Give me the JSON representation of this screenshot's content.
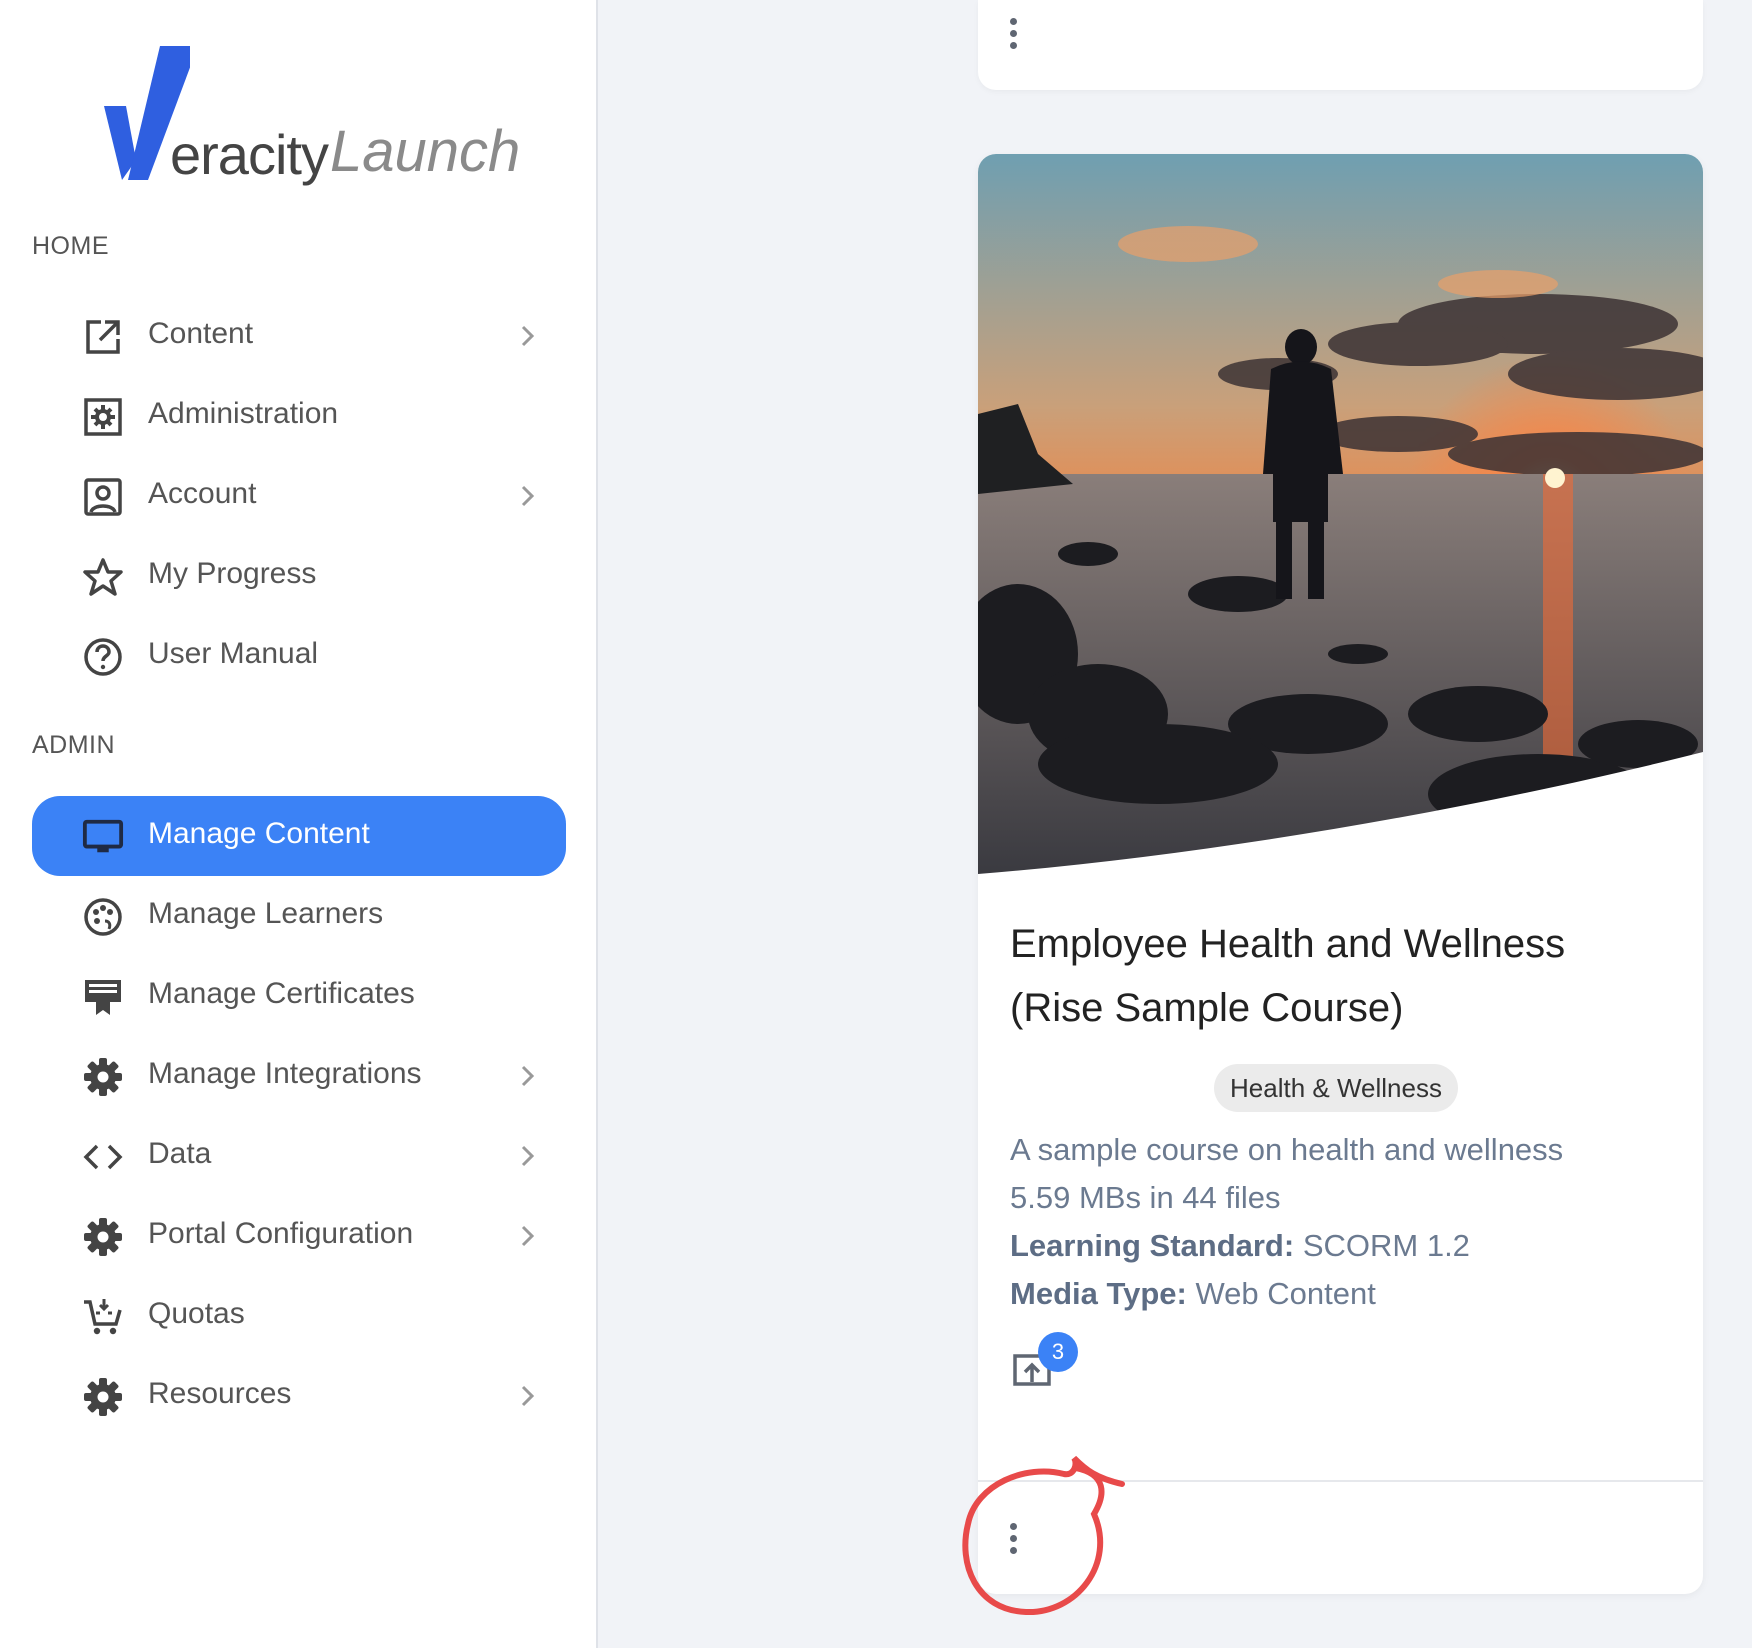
{
  "brand": {
    "name_part1": "eracity",
    "name_part2": "Launch",
    "primary_color": "#2f5fe0",
    "accent_color": "#3b82f6"
  },
  "sidebar": {
    "home_title": "HOME",
    "admin_title": "ADMIN",
    "home_items": [
      {
        "label": "Content",
        "icon": "external-link-icon",
        "has_submenu": true
      },
      {
        "label": "Administration",
        "icon": "settings-box-icon",
        "has_submenu": false
      },
      {
        "label": "Account",
        "icon": "user-box-icon",
        "has_submenu": true
      },
      {
        "label": "My Progress",
        "icon": "star-icon",
        "has_submenu": false
      },
      {
        "label": "User Manual",
        "icon": "help-circle-icon",
        "has_submenu": false
      }
    ],
    "admin_items": [
      {
        "label": "Manage Content",
        "icon": "monitor-icon",
        "has_submenu": false,
        "active": true
      },
      {
        "label": "Manage Learners",
        "icon": "palette-icon",
        "has_submenu": false
      },
      {
        "label": "Manage Certificates",
        "icon": "certificate-icon",
        "has_submenu": false
      },
      {
        "label": "Manage Integrations",
        "icon": "gear-icon",
        "has_submenu": true
      },
      {
        "label": "Data",
        "icon": "code-icon",
        "has_submenu": true
      },
      {
        "label": "Portal Configuration",
        "icon": "gear-icon",
        "has_submenu": true
      },
      {
        "label": "Quotas",
        "icon": "cart-icon",
        "has_submenu": false
      },
      {
        "label": "Resources",
        "icon": "gear-icon",
        "has_submenu": true
      }
    ]
  },
  "card": {
    "title_line1": "Employee Health and Wellness",
    "title_line2": "(Rise Sample Course)",
    "tag": "Health & Wellness",
    "description": "A sample course on health and wellness",
    "size_info": "5.59 MBs in 44 files",
    "standard_label": "Learning Standard:",
    "standard_value": "SCORM 1.2",
    "media_label": "Media Type:",
    "media_value": "Web Content",
    "launch_count": "3",
    "image": "sunset-man-on-rocks-image"
  },
  "annotation": {
    "color": "#e84a4a",
    "target": "card-more-options-button"
  }
}
